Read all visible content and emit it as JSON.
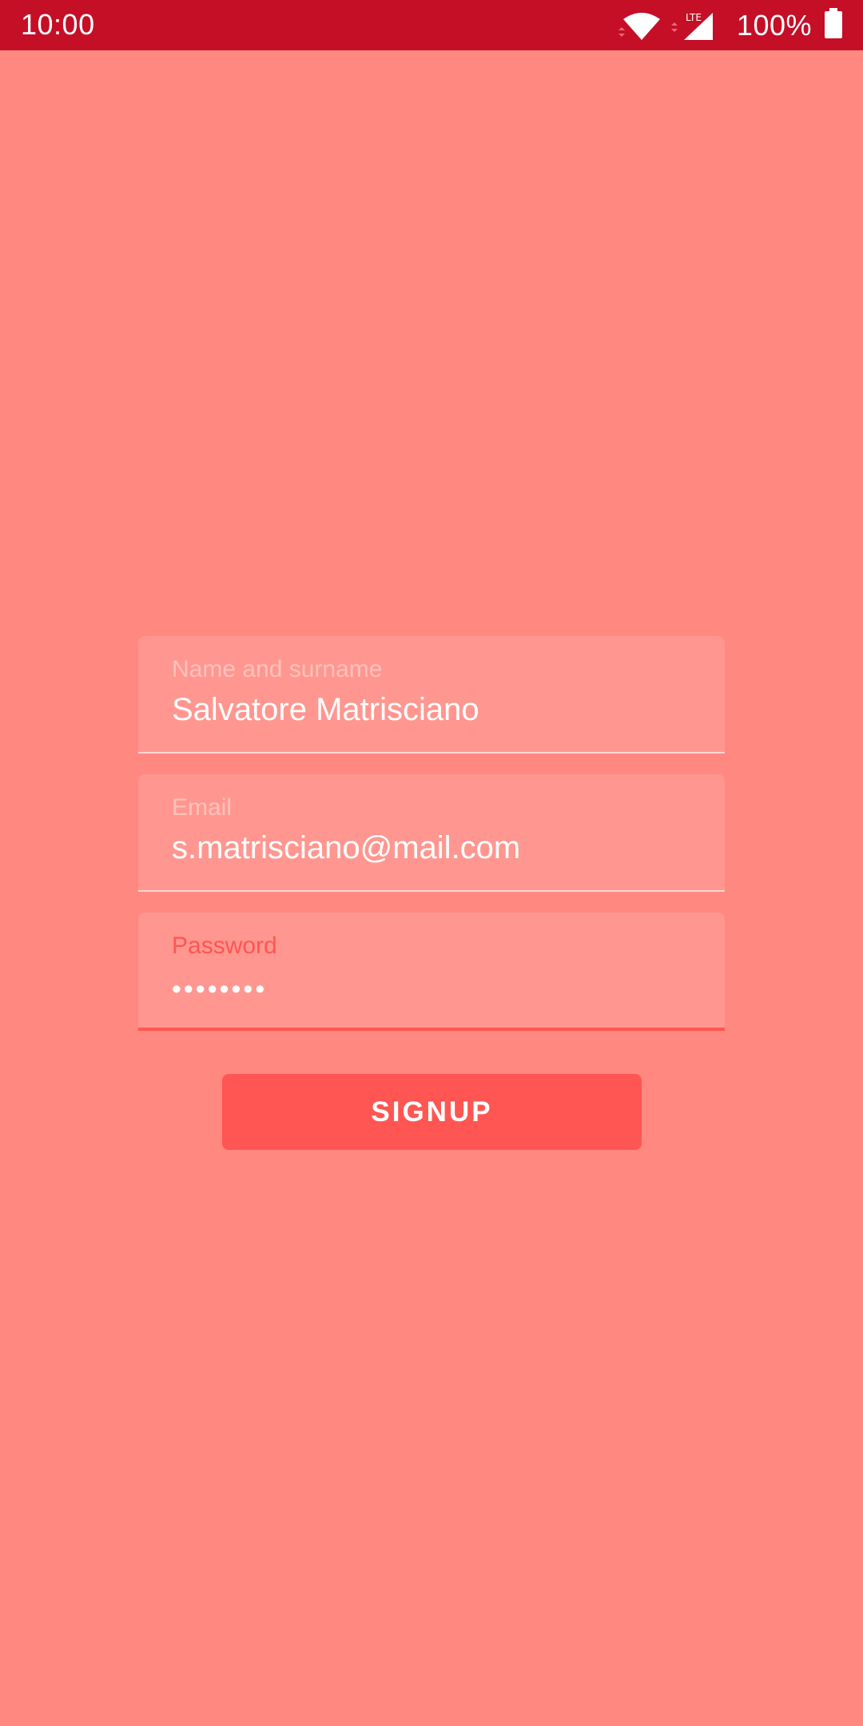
{
  "status_bar": {
    "time": "10:00",
    "network_type": "LTE",
    "battery": "100%",
    "icons": [
      "wifi-icon",
      "cell-signal-icon",
      "battery-icon"
    ]
  },
  "form": {
    "name_field": {
      "label": "Name and surname",
      "value": "Salvatore Matrisciano"
    },
    "email_field": {
      "label": "Email",
      "value": "s.matrisciano@mail.com"
    },
    "password_field": {
      "label": "Password",
      "value": "••••••••"
    },
    "submit_label": "SIGNUP"
  },
  "colors": {
    "background": "#ff8880",
    "status_bar": "#c40f27",
    "field_fill": "#ff9790",
    "accent": "#ff5552",
    "button": "#ff5653"
  }
}
